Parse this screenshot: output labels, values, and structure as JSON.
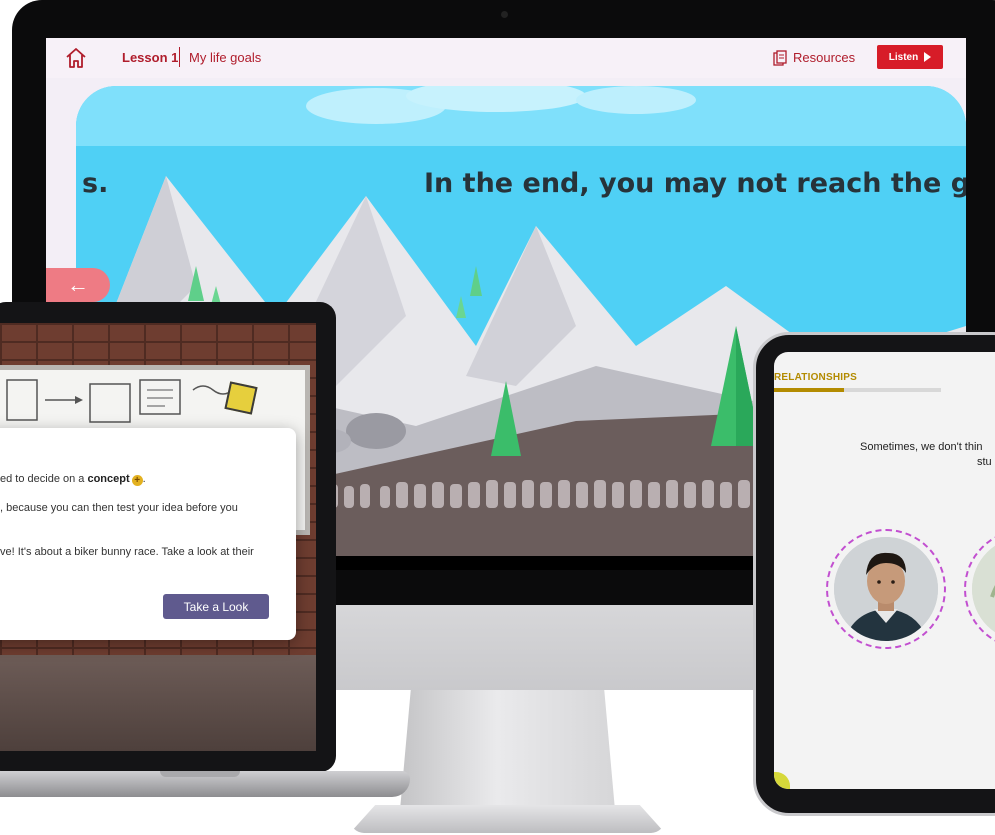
{
  "desktop": {
    "lesson_label": "Lesson 1",
    "lesson_subtitle": "My life goals",
    "resources_label": "Resources",
    "listen_label": "Listen",
    "scroll_text_left": "s.",
    "scroll_text_right": "In the end, you may not reach the g",
    "back_icon": "arrow-left-icon",
    "home_icon": "home-icon",
    "colors": {
      "brand": "#b01d2c",
      "listen_bg": "#d71c28",
      "back_button": "#ee7b84",
      "sky": "#4fd0f5"
    }
  },
  "laptop": {
    "dialog": {
      "line1_prefix": "ed to decide on a ",
      "line1_bold": "concept",
      "line1_suffix": ".",
      "line2": ", because you can then test your idea before you",
      "line3": "ve! It's about a biker bunny race. Take a look at their",
      "button_label": "Take a Look"
    },
    "concept_icon": "plus-circle-icon",
    "colors": {
      "button": "#5f5a8e"
    }
  },
  "tablet": {
    "section_title": "RELATIONSHIPS",
    "progress": 0.42,
    "text_line1": "Sometimes, we don't thin",
    "text_line2": "stu",
    "avatars": [
      "student-portrait-1",
      "student-portrait-2"
    ],
    "colors": {
      "accent": "#b38b00",
      "avatar_ring": "#c24fd0"
    }
  }
}
